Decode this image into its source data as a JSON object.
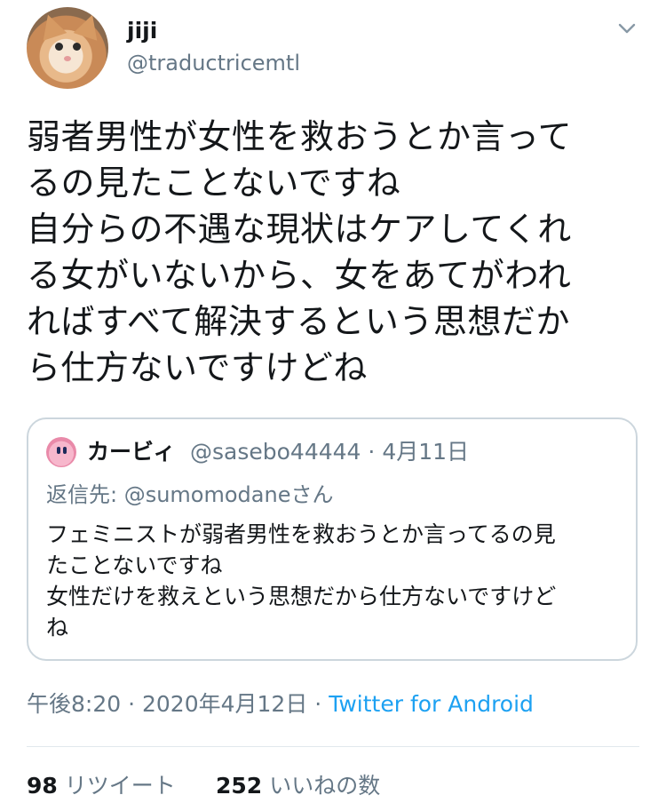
{
  "author": {
    "display_name": "jiji",
    "handle": "@traductricemtl"
  },
  "tweet": {
    "lines": [
      "弱者男性が女性を救おうとか言って",
      "るの見たことないですね",
      "自分らの不遇な現状はケアしてくれ",
      "る女がいないから、女をあてがわれ",
      "ればすべて解決するという思想だか",
      "ら仕方ないですけどね"
    ]
  },
  "quoted_tweet": {
    "display_name": "カービィ",
    "handle": "@sasebo44444",
    "separator": "·",
    "date": "4月11日",
    "reply_to": "返信先: @sumomodaneさん",
    "lines": [
      "フェミニストが弱者男性を救おうとか言ってるの見",
      "たことないですね",
      "女性だけを救えという思想だから仕方ないですけど",
      "ね"
    ]
  },
  "meta": {
    "time": "午後8:20",
    "separator": "·",
    "date": "2020年4月12日",
    "source": "Twitter for Android"
  },
  "stats": {
    "retweets_count": "98",
    "retweets_label": "リツイート",
    "likes_count": "252",
    "likes_label": "いいねの数"
  },
  "icons": {
    "menu": "chevron-down-icon",
    "author_avatar": "cat-avatar",
    "quoted_avatar": "kirby-avatar"
  },
  "colors": {
    "text_primary": "#14171a",
    "text_secondary": "#657786",
    "link": "#1da1f2",
    "border": "#ccd6dd"
  }
}
